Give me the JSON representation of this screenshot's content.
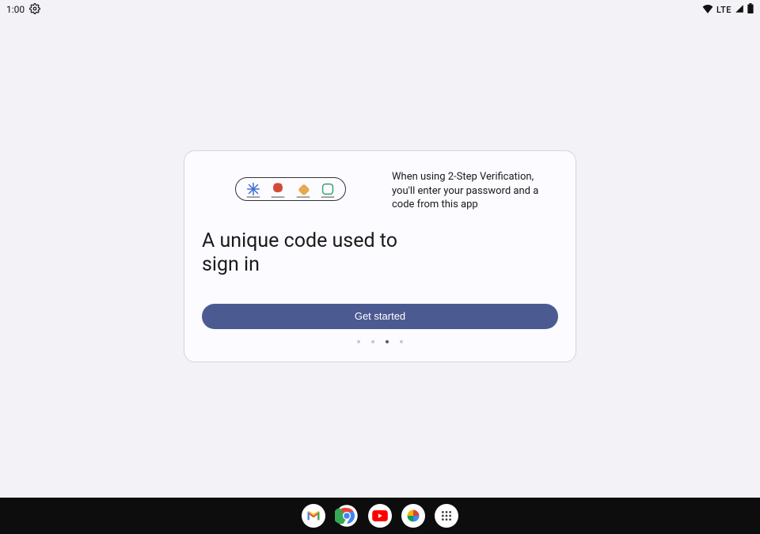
{
  "status_bar": {
    "time": "1:00",
    "network_label": "LTE"
  },
  "card": {
    "headline": "A unique code used to sign in",
    "description": "When using 2-Step Verification, you'll enter your password and a code from this app",
    "cta_label": "Get started",
    "page_count": 4,
    "active_page_index": 2
  },
  "taskbar": {
    "apps": [
      "gmail",
      "chrome",
      "youtube",
      "photos",
      "all-apps"
    ]
  }
}
